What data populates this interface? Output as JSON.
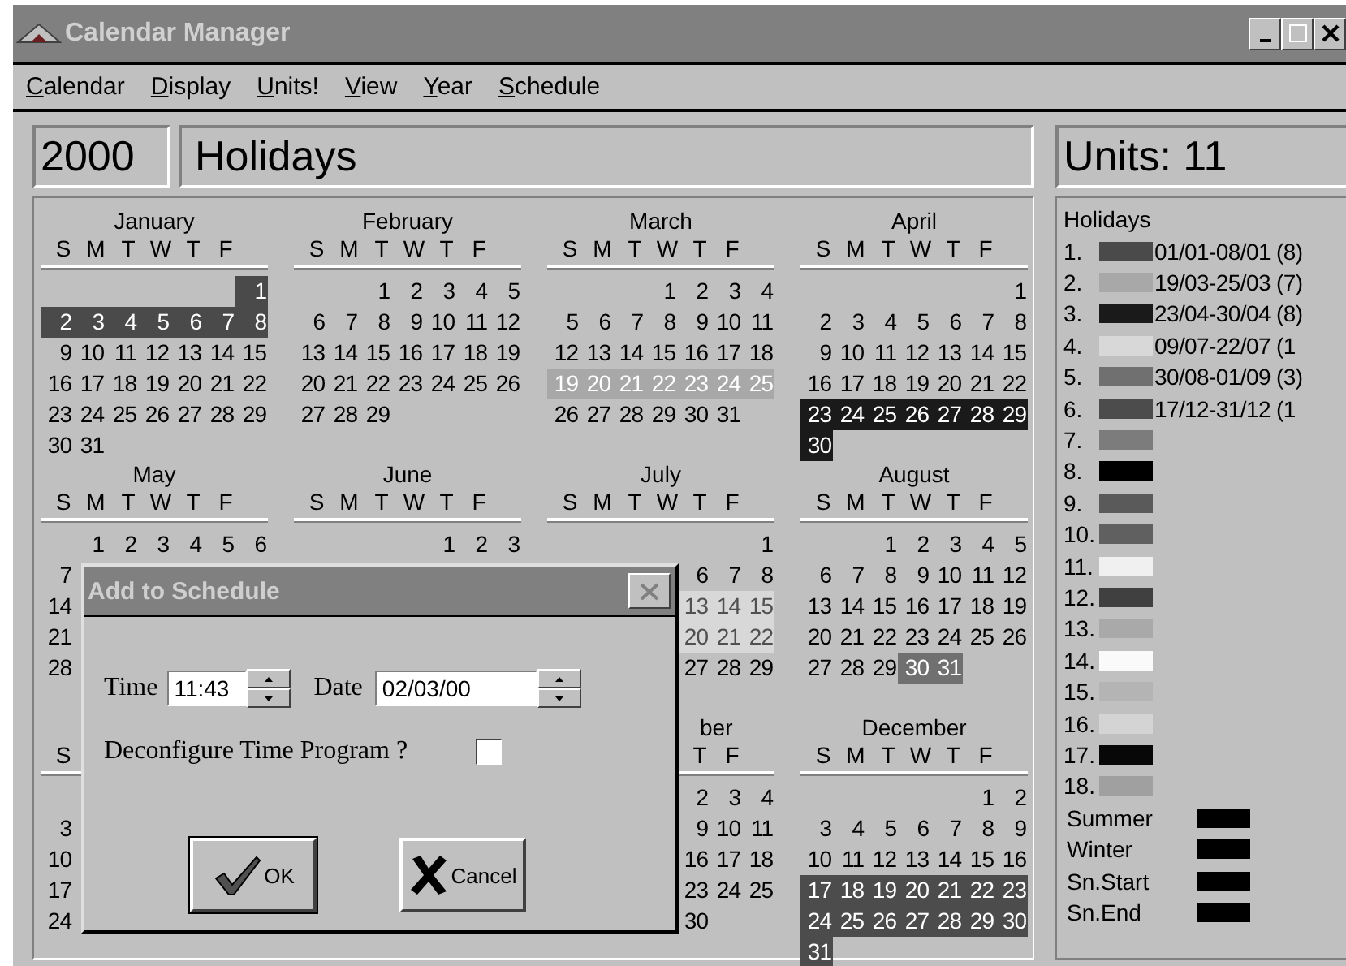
{
  "window": {
    "title": "Calendar Manager"
  },
  "menu": [
    "Calendar",
    "Display",
    "Units!",
    "View",
    "Year",
    "Schedule"
  ],
  "year": "2000",
  "calendar_name": "Holidays",
  "units": "Units: 11",
  "months": [
    {
      "kind": "month",
      "name": "January",
      "weekdays": [
        "S",
        "M",
        "T",
        "W",
        "T",
        "F"
      ],
      "days": [
        {
          "day": "1",
          "color": "#4a4a4a"
        },
        {
          "day": "2",
          "color": "#4a4a4a"
        },
        {
          "day": "3",
          "color": "#4a4a4a"
        },
        {
          "day": "4",
          "color": "#4a4a4a"
        },
        {
          "day": "5",
          "color": "#4a4a4a"
        },
        {
          "day": "6",
          "color": "#4a4a4a"
        },
        {
          "day": "7",
          "color": "#4a4a4a"
        },
        {
          "day": "8",
          "color": "#4a4a4a"
        },
        "9",
        "10",
        "11",
        "12",
        "13",
        "14",
        "15",
        "16",
        "17",
        "18",
        "19",
        "20",
        "21",
        "22",
        "23",
        "24",
        "25",
        "26",
        "27",
        "28",
        "29",
        "30",
        "31"
      ]
    },
    {
      "kind": "month",
      "name": "February",
      "weekdays": [
        "S",
        "M",
        "T",
        "W",
        "T",
        "F"
      ],
      "days": [
        "1",
        "2",
        "3",
        "4",
        "5",
        "6",
        "7",
        "8",
        "9",
        "10",
        "11",
        "12",
        "13",
        "14",
        "15",
        "16",
        "17",
        "18",
        "19",
        "20",
        "21",
        "22",
        "23",
        "24",
        "25",
        "26",
        "27",
        "28",
        "29"
      ]
    },
    {
      "kind": "month",
      "name": "March",
      "weekdays": [
        "S",
        "M",
        "T",
        "W",
        "T",
        "F"
      ],
      "days": [
        "1",
        "2",
        "3",
        "4",
        "5",
        "6",
        "7",
        "8",
        "9",
        "10",
        "11",
        "12",
        "13",
        "14",
        "15",
        "16",
        "17",
        "18",
        {
          "day": "19",
          "color": "#a8a8a8"
        },
        {
          "day": "20",
          "color": "#a8a8a8"
        },
        {
          "day": "21",
          "color": "#a8a8a8"
        },
        {
          "day": "22",
          "color": "#a8a8a8"
        },
        {
          "day": "23",
          "color": "#a8a8a8"
        },
        {
          "day": "24",
          "color": "#a8a8a8"
        },
        {
          "day": "25",
          "color": "#a8a8a8"
        },
        "26",
        "27",
        "28",
        "29",
        "30",
        "31"
      ]
    },
    {
      "kind": "month",
      "name": "April",
      "weekdays": [
        "S",
        "M",
        "T",
        "W",
        "T",
        "F"
      ],
      "days": [
        "1",
        "2",
        "3",
        "4",
        "5",
        "6",
        "7",
        "8",
        "9",
        "10",
        "11",
        "12",
        "13",
        "14",
        "15",
        "16",
        "17",
        "18",
        "19",
        "20",
        "21",
        "22",
        {
          "day": "23",
          "color": "#1a1a1a"
        },
        {
          "day": "24",
          "color": "#1a1a1a"
        },
        {
          "day": "25",
          "color": "#1a1a1a"
        },
        {
          "day": "26",
          "color": "#1a1a1a"
        },
        {
          "day": "27",
          "color": "#1a1a1a"
        },
        {
          "day": "28",
          "color": "#1a1a1a"
        },
        {
          "day": "29",
          "color": "#1a1a1a"
        },
        {
          "day": "30",
          "color": "#1a1a1a"
        }
      ]
    },
    {
      "kind": "month",
      "name": "May",
      "weekdays": [
        "S",
        "M",
        "T",
        "W",
        "T",
        "F"
      ],
      "days": [
        "1",
        "2",
        "3",
        "4",
        "5",
        "6",
        "7",
        "14",
        "21",
        "28"
      ]
    },
    {
      "kind": "month",
      "name": "June",
      "weekdays": [
        "S",
        "M",
        "T",
        "W",
        "T",
        "F"
      ],
      "days": [
        "1",
        "2",
        "3"
      ]
    },
    {
      "kind": "month",
      "name": "July",
      "weekdays": [
        "S",
        "M",
        "T",
        "W",
        "T",
        "F"
      ],
      "days": [
        "1",
        "6",
        "7",
        "8",
        {
          "day": "13",
          "color": "#d8d8d8"
        },
        {
          "day": "14",
          "color": "#d8d8d8"
        },
        {
          "day": "15",
          "color": "#d8d8d8"
        },
        {
          "day": "20",
          "color": "#d8d8d8"
        },
        {
          "day": "21",
          "color": "#d8d8d8"
        },
        {
          "day": "22",
          "color": "#d8d8d8"
        },
        "27",
        "28",
        "29"
      ]
    },
    {
      "kind": "month",
      "name": "August",
      "weekdays": [
        "S",
        "M",
        "T",
        "W",
        "T",
        "F"
      ],
      "days": [
        "1",
        "2",
        "3",
        "4",
        "5",
        "6",
        "7",
        "8",
        "9",
        "10",
        "11",
        "12",
        "13",
        "14",
        "15",
        "16",
        "17",
        "18",
        "19",
        "20",
        "21",
        "22",
        "23",
        "24",
        "25",
        "26",
        "27",
        "28",
        "29",
        {
          "day": "30",
          "color": "#707070"
        },
        {
          "day": "31",
          "color": "#707070"
        }
      ]
    },
    {
      "kind": "month",
      "weekdays": [
        "S"
      ],
      "days": [
        "3",
        "10",
        "17",
        "24"
      ]
    },
    {
      "kind": "covered"
    },
    {
      "kind": "clipped",
      "name": "ber",
      "weekdays": [
        {
          "kind": "empty"
        },
        {
          "kind": "empty"
        },
        {
          "kind": "empty"
        },
        {
          "kind": "empty"
        },
        "T",
        "F"
      ],
      "days": [
        "2",
        "3",
        "4",
        "9",
        "10",
        "11",
        "16",
        "17",
        "18",
        "23",
        "24",
        "25",
        "30"
      ]
    },
    {
      "kind": "month",
      "name": "December",
      "weekdays": [
        "S",
        "M",
        "T",
        "W",
        "T",
        "F"
      ],
      "days": [
        "1",
        "2",
        "3",
        "4",
        "5",
        "6",
        "7",
        "8",
        "9",
        "10",
        "11",
        "12",
        "13",
        "14",
        "15",
        "16",
        {
          "day": "17",
          "color": "#4c4c4c"
        },
        {
          "day": "18",
          "color": "#4c4c4c"
        },
        {
          "day": "19",
          "color": "#4c4c4c"
        },
        {
          "day": "20",
          "color": "#4c4c4c"
        },
        {
          "day": "21",
          "color": "#4c4c4c"
        },
        {
          "day": "22",
          "color": "#4c4c4c"
        },
        {
          "day": "23",
          "color": "#4c4c4c"
        },
        {
          "day": "24",
          "color": "#4c4c4c"
        },
        {
          "day": "25",
          "color": "#4c4c4c"
        },
        {
          "day": "26",
          "color": "#4c4c4c"
        },
        {
          "day": "27",
          "color": "#4c4c4c"
        },
        {
          "day": "28",
          "color": "#4c4c4c"
        },
        {
          "day": "29",
          "color": "#4c4c4c"
        },
        {
          "day": "30",
          "color": "#4c4c4c"
        },
        {
          "day": "31",
          "color": "#4c4c4c"
        }
      ]
    }
  ],
  "legend": {
    "title": "Holidays",
    "entries": [
      {
        "number": "1.",
        "color": "#4a4a4a",
        "range": "01/01-08/01 (8)"
      },
      {
        "number": "2.",
        "color": "#a8a8a8",
        "range": "19/03-25/03 (7)"
      },
      {
        "number": "3.",
        "color": "#1a1a1a",
        "range": "23/04-30/04 (8)"
      },
      {
        "number": "4.",
        "color": "#d8d8d8",
        "range": "09/07-22/07 (1"
      },
      {
        "number": "5.",
        "color": "#707070",
        "range": "30/08-01/09 (3)"
      },
      {
        "number": "6.",
        "color": "#4c4c4c",
        "range": "17/12-31/12 (1"
      },
      {
        "number": "7.",
        "color": "#7c7c7c"
      },
      {
        "number": "8.",
        "color": "#000000"
      },
      {
        "number": "9.",
        "color": "#5a5a5a"
      },
      {
        "number": "10.",
        "color": "#606060"
      },
      {
        "number": "11.",
        "color": "#f0f0f0"
      },
      {
        "number": "12.",
        "color": "#404040"
      },
      {
        "number": "13.",
        "color": "#a9a9a9"
      },
      {
        "number": "14.",
        "color": "#fafafa"
      },
      {
        "number": "15.",
        "color": "#b4b4b4"
      },
      {
        "number": "16.",
        "color": "#d4d4d4"
      },
      {
        "number": "17.",
        "color": "#080808"
      },
      {
        "number": "18.",
        "color": "#a0a0a0"
      }
    ],
    "seasons": [
      {
        "label": "Summer",
        "color": "#000000"
      },
      {
        "label": "Winter",
        "color": "#000000"
      },
      {
        "label": "Sn.Start",
        "color": "#000000"
      },
      {
        "label": "Sn.End",
        "color": "#000000"
      }
    ]
  },
  "dialog": {
    "title": "Add to Schedule",
    "time_label": "Time",
    "time": "11:43",
    "date_label": "Date",
    "date": "02/03/00",
    "checkbox": {
      "label": "Deconfigure Time Program ?",
      "checked": false
    },
    "buttons": [
      {
        "kind": "ok",
        "label": "OK"
      },
      {
        "kind": "cancel",
        "label": "Cancel"
      }
    ]
  }
}
